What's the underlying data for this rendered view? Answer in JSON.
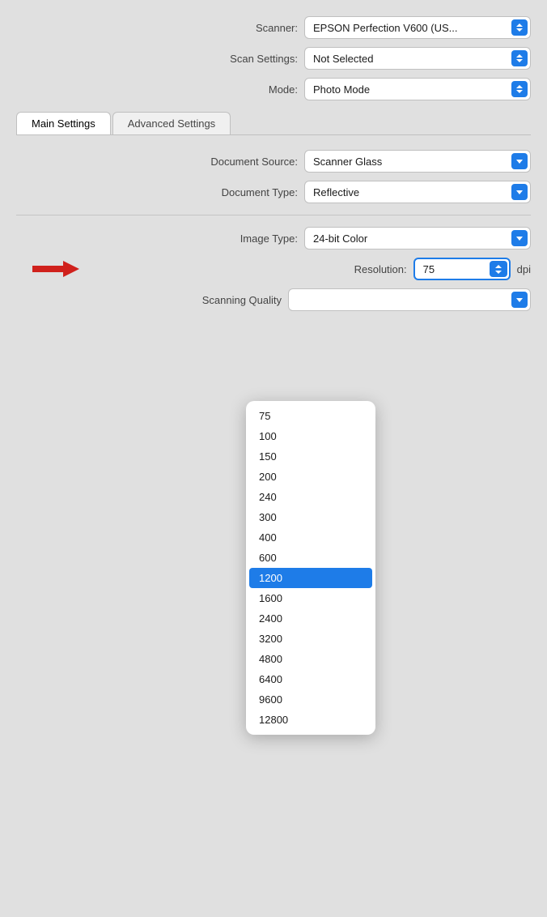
{
  "scanner": {
    "label": "Scanner:",
    "value": "EPSON Perfection V600 (US...",
    "options": [
      "EPSON Perfection V600 (US..."
    ]
  },
  "scan_settings": {
    "label": "Scan Settings:",
    "value": "Not Selected",
    "options": [
      "Not Selected"
    ]
  },
  "mode": {
    "label": "Mode:",
    "value": "Photo Mode",
    "options": [
      "Photo Mode"
    ]
  },
  "tabs": {
    "main": "Main Settings",
    "advanced": "Advanced Settings"
  },
  "document_source": {
    "label": "Document Source:",
    "value": "Scanner Glass",
    "options": [
      "Scanner Glass"
    ]
  },
  "document_type": {
    "label": "Document Type:",
    "value": "Reflective",
    "options": [
      "Reflective"
    ]
  },
  "image_type": {
    "label": "Image Type:",
    "value": "24-bit Color",
    "options": [
      "24-bit Color"
    ]
  },
  "resolution": {
    "label": "Resolution:",
    "value": "75",
    "dpi": "dpi",
    "options": [
      "75",
      "100",
      "150",
      "200",
      "240",
      "300",
      "400",
      "600",
      "1200",
      "1600",
      "2400",
      "3200",
      "4800",
      "6400",
      "9600",
      "12800"
    ],
    "selected": "1200"
  },
  "scanning_quality": {
    "label": "Scanning Quality",
    "value": ""
  },
  "colors": {
    "accent": "#1e7ce8",
    "arrow_red": "#d0211c"
  }
}
